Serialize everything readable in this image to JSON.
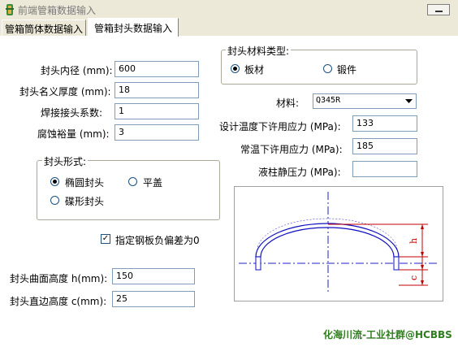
{
  "window": {
    "title": "前端管箱数据输入"
  },
  "tabs": [
    {
      "label": "管箱筒体数据输入"
    },
    {
      "label": "管箱封头数据输入"
    }
  ],
  "left_fields": [
    {
      "label": "封头内径 (mm):",
      "value": "600"
    },
    {
      "label": "封头名义厚度 (mm):",
      "value": "18"
    },
    {
      "label": "焊接接头系数:",
      "value": "1"
    },
    {
      "label": "腐蚀裕量 (mm):",
      "value": "3"
    }
  ],
  "head_form": {
    "legend": "封头形式:",
    "options": [
      {
        "label": "椭圆封头",
        "selected": true
      },
      {
        "label": "平盖",
        "selected": false
      },
      {
        "label": "碟形封头",
        "selected": false
      }
    ]
  },
  "negative_tolerance": {
    "label": "指定钢板负偏差为0",
    "checked": true
  },
  "bottom_fields": [
    {
      "label": "封头曲面高度 h(mm):",
      "value": "150"
    },
    {
      "label": "封头直边高度 c(mm):",
      "value": "25"
    }
  ],
  "material_type": {
    "legend": "封头材料类型:",
    "options": [
      {
        "label": "板材",
        "selected": true
      },
      {
        "label": "锻件",
        "selected": false
      }
    ]
  },
  "material": {
    "label": "材料:",
    "value": "Q345R"
  },
  "right_fields": [
    {
      "label": "设计温度下许用应力 (MPa):",
      "value": "133"
    },
    {
      "label": "常温下许用应力 (MPa):",
      "value": "185"
    },
    {
      "label": "液柱静压力 (MPa):",
      "value": ""
    }
  ],
  "diagram": {
    "h_label": "h",
    "c_label": "c"
  },
  "watermark": "化海川流-工业社群@HCBBS"
}
